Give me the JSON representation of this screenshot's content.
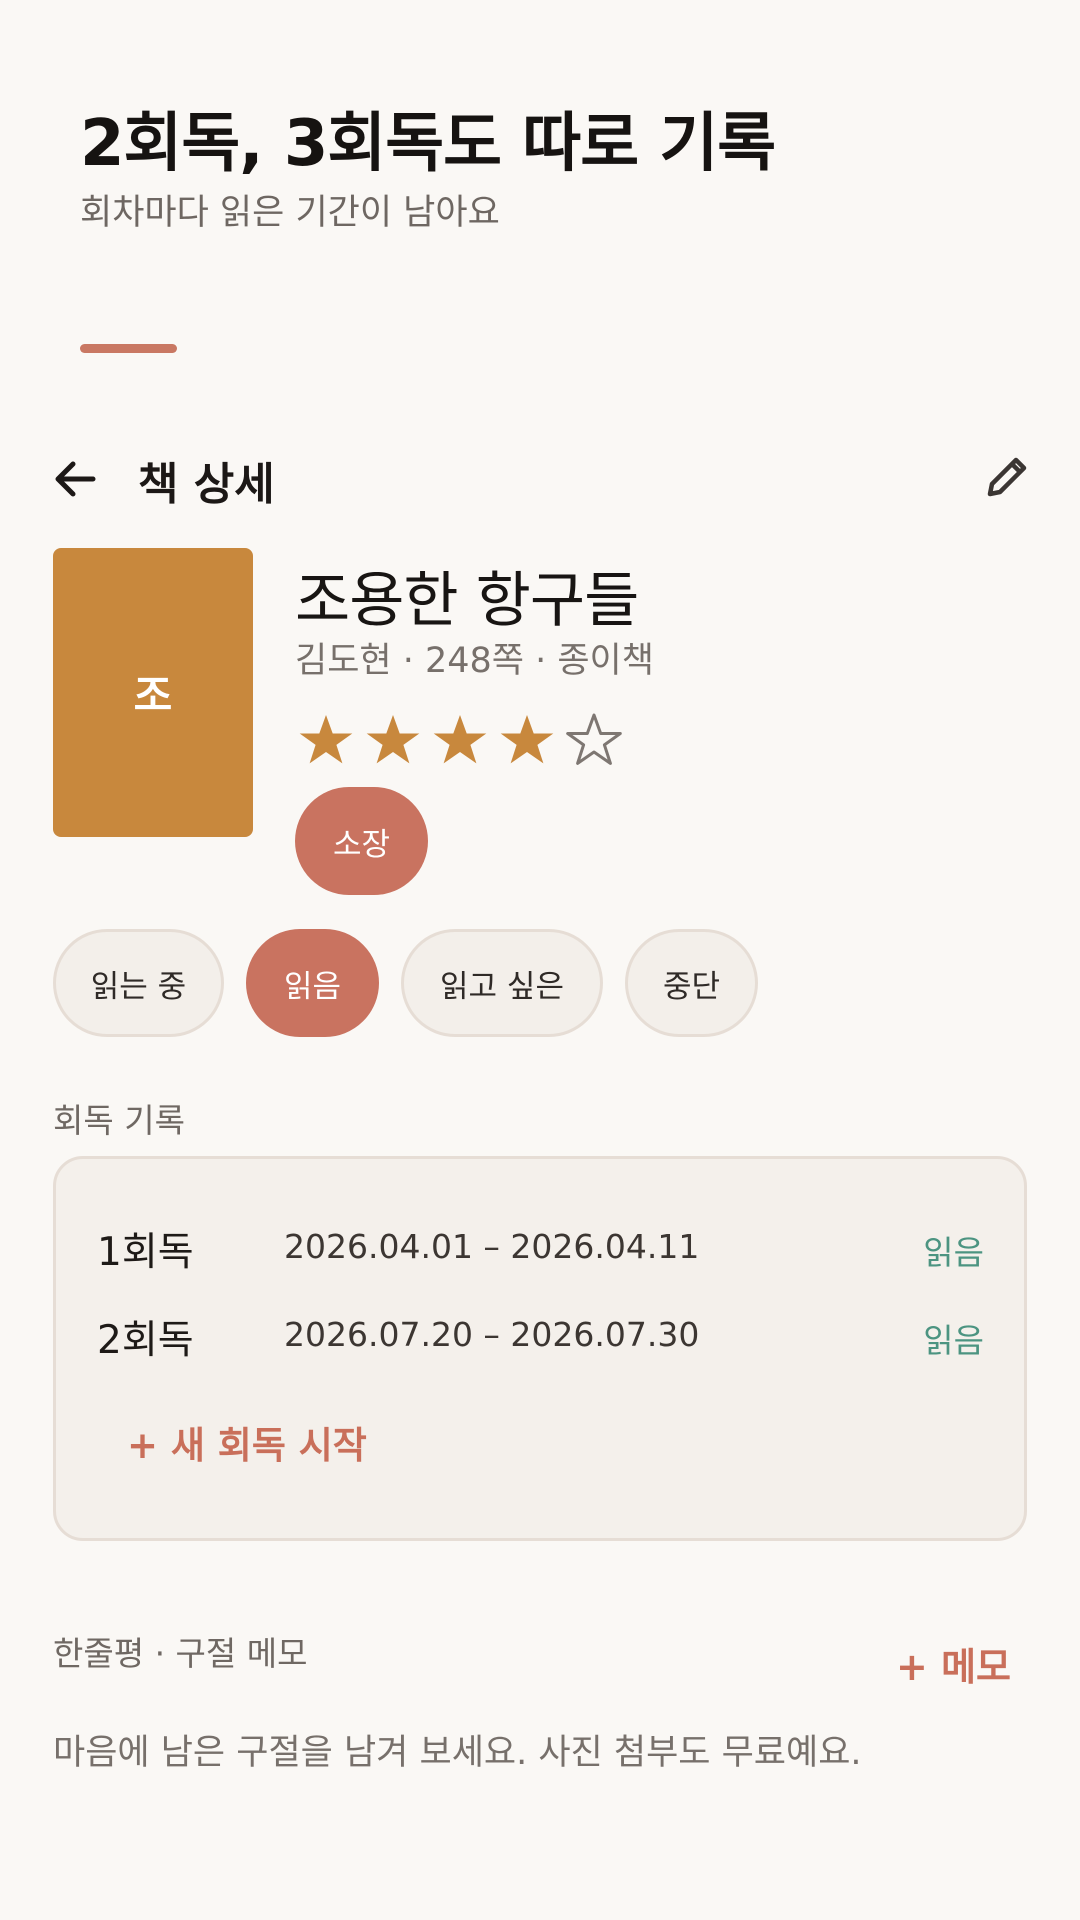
{
  "promo": {
    "title": "2회독, 3회독도 따로 기록",
    "subtitle": "회차마다 읽은 기간이 남아요"
  },
  "app_bar": {
    "title": "책 상세",
    "back_icon": "arrow-left-icon",
    "edit_icon": "pencil-icon"
  },
  "book": {
    "cover_initial": "조",
    "title": "조용한 항구들",
    "meta": "김도현 · 248쪽 · 종이책",
    "rating": 4,
    "rating_max": 5,
    "owned_label": "소장"
  },
  "status_chips": [
    {
      "label": "읽는 중",
      "active": false
    },
    {
      "label": "읽음",
      "active": true
    },
    {
      "label": "읽고 싶은",
      "active": false
    },
    {
      "label": "중단",
      "active": false
    }
  ],
  "reading_rounds": {
    "section_label": "회독 기록",
    "rounds": [
      {
        "label": "1회독",
        "dates": "2026.04.01 – 2026.04.11",
        "status": "읽음"
      },
      {
        "label": "2회독",
        "dates": "2026.07.20 – 2026.07.30",
        "status": "읽음"
      }
    ],
    "new_round_label": "+ 새 회독 시작"
  },
  "memo": {
    "section_label": "한줄평 · 구절 메모",
    "add_label": "+ 메모",
    "empty_text": "마음에 남은 구절을 남겨 보세요. 사진 첨부도 무료예요."
  },
  "colors": {
    "accent": "#c97360",
    "cover": "#c8883d",
    "star": "#c8883d",
    "status_read": "#4c9481",
    "background": "#faf8f5"
  }
}
